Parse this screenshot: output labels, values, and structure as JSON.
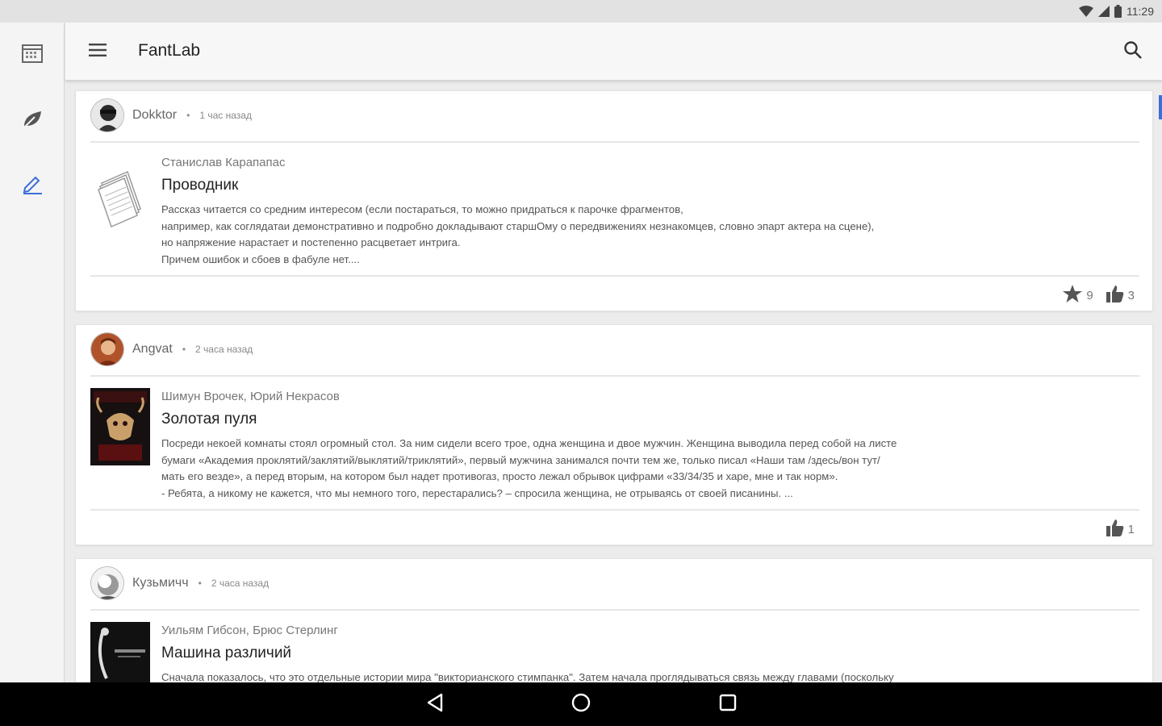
{
  "status_bar": {
    "time": "11:29",
    "icons": [
      "wifi-icon",
      "cell-signal-icon",
      "battery-icon"
    ]
  },
  "app_bar": {
    "title": "FantLab",
    "menu_icon": "hamburger-menu-icon",
    "search_icon": "search-icon"
  },
  "nav_rail": {
    "items": [
      "calendar-icon",
      "leaf-icon",
      "pencil-icon"
    ],
    "active_item": "pencil-icon",
    "accent_color": "#3b6fd8"
  },
  "reviews": [
    {
      "author": "Dokktor",
      "time": "1 час назад",
      "work_author": "Станислав Карапапас",
      "work_title": "Проводник",
      "text": "Рассказ читается со средним интересом (если постараться, то можно придраться к парочке фрагментов,\nнапример, как соглядатаи демонстративно и подробно докладывают старшОму о передвижениях незнакомцев, словно эпарт актера на сцене),\nно напряжение нарастает и постепенно расцветает интрига.\nПричем ошибок и сбоев в фабуле нет....",
      "rating": "9",
      "likes": "3"
    },
    {
      "author": "Angvat",
      "time": "2 часа назад",
      "work_author": "Шимун Врочек, Юрий Некрасов",
      "work_title": "Золотая пуля",
      "text": "Посреди некоей комнаты стоял огромный стол. За ним сидели всего трое, одна женщина и двое мужчин. Женщина выводила перед собой на листе\nбумаги «Академия проклятий/заклятий/выклятий/триклятий», первый мужчина занимался почти тем же, только писал «Наши там /здесь/вон тут/\nмать его везде», а перед вторым, на котором был надет противогаз, просто лежал обрывок  цифрами «33/34/35 и харе, мне и так норм».\n- Ребята, а никому не кажется, что мы немного того, перестарались? – спросила женщина, не отрываясь от своей писанины. ...",
      "likes": "1"
    },
    {
      "author": "Кузьмичч",
      "time": "2 часа назад",
      "work_author": "Уильям Гибсон, Брюс Стерлинг",
      "work_title": "Машина различий",
      "text": "Сначала показалось, что это отдельные истории мира \"викторианского стимпанка\". Затем начала проглядываться связь между главами (поскольку"
    }
  ],
  "covers": {
    "cover_1_lettering": "ЗОЛОТАЯ ПУЛЯ"
  },
  "bottom_nav": [
    "back-triangle-icon",
    "home-circle-icon",
    "recents-square-icon"
  ]
}
